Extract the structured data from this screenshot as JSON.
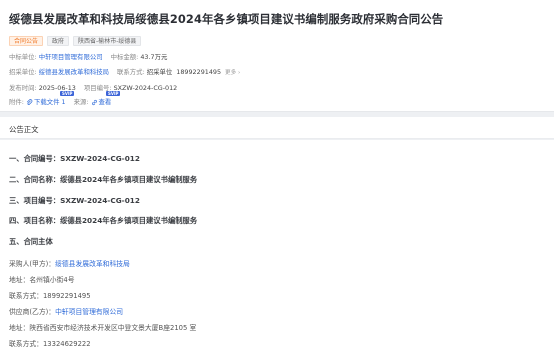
{
  "header": {
    "title": "绥德县发展改革和科技局绥德县2024年各乡镇项目建议书编制服务政府采购合同公告",
    "tags": [
      "合同公告",
      "政府",
      "陕西省-榆林市-绥德县"
    ],
    "winner_label": "中标单位:",
    "winner_value": "中轩项目管理有限公司",
    "amount_label": "中标金额:",
    "amount_value": "43.7万元",
    "buyer_label": "招采单位:",
    "buyer_value": "绥德县发展改革和科技局",
    "contact_label": "联系方式:",
    "contact_name": "招采单位",
    "contact_phone": "18992291495",
    "more_label": "更多 ›",
    "publish_label": "发布时间:",
    "publish_value": "2025-06-13",
    "project_no_label": "项目编号:",
    "project_no_value": "SXZW-2024-CG-012",
    "svip_badge": "SVIP",
    "attach_label": "附件:",
    "attach_value": "下载文件 1",
    "source_label": "来源:",
    "source_value": "查看"
  },
  "section": {
    "title": "公告正文"
  },
  "content": {
    "h1": "一、合同编号：SXZW-2024-CG-012",
    "h2": "二、合同名称：绥德县2024年各乡镇项目建议书编制服务",
    "h3": "三、项目编号：SXZW-2024-CG-012",
    "h4": "四、项目名称：绥德县2024年各乡镇项目建议书编制服务",
    "h5": "五、合同主体",
    "buyer_label": "采购人(甲方)：",
    "buyer_value": "绥德县发展改革和科技局",
    "buyer_address": "地址：名州镇小街4号",
    "buyer_phone": "联系方式：18992291495",
    "supplier_label": "供应商(乙方)：",
    "supplier_value": "中轩项目管理有限公司",
    "supplier_address": "地址：陕西省西安市经济技术开发区中登文景大厦B座2105 室",
    "supplier_phone": "联系方式：13324629222"
  },
  "colors": {
    "link": "#2f6bd8",
    "tag_orange": "#f07a2a",
    "svip": "#3c64d8"
  }
}
